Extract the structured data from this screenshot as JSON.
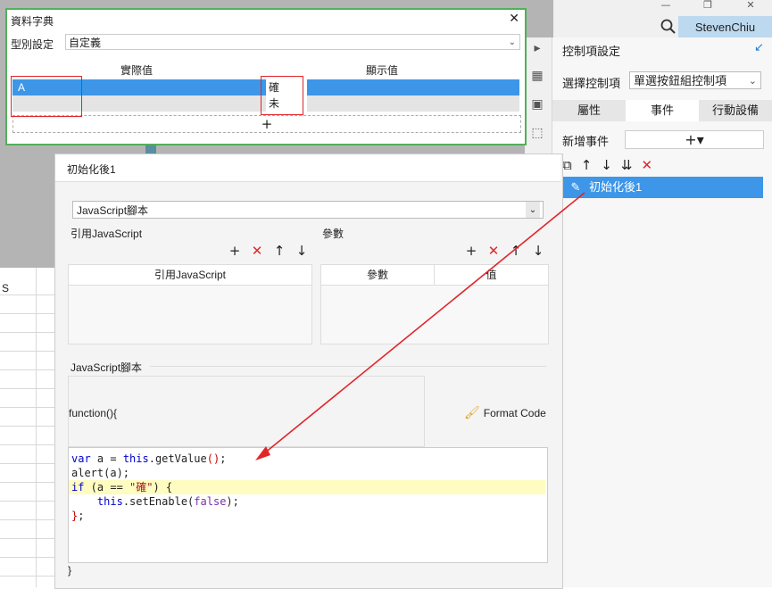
{
  "app": {
    "user": "StevenChiu",
    "window_buttons": {
      "minimize": "—",
      "restore": "❐",
      "close": "✕"
    },
    "sheet_header": "S"
  },
  "dict": {
    "title": "資料字典",
    "type_label": "型別設定",
    "type_value": "自定義",
    "col_actual": "實際值",
    "col_display": "顯示值",
    "rows": [
      {
        "actual": "A",
        "display": "確"
      },
      {
        "actual": "",
        "display": "未"
      }
    ],
    "add": "+"
  },
  "panel": {
    "title": "控制項設定",
    "select_label": "選擇控制項",
    "select_value": "單選按鈕組控制項",
    "tabs": [
      "屬性",
      "事件",
      "行動設備"
    ],
    "add_event_label": "新增事件",
    "add_event_btn": "+▾",
    "event_item": "初始化後1"
  },
  "event_dialog": {
    "title": "初始化後1",
    "script_type": "JavaScript腳本",
    "ref_js_label": "引用JavaScript",
    "params_label": "參數",
    "ref_js_col": "引用JavaScript",
    "param_col": "參數",
    "value_col": "值",
    "script_label": "JavaScript腳本",
    "func_open": "function(){",
    "format_code": "Format Code",
    "func_close": "}",
    "code": [
      "var a = this.getValue();",
      "alert(a);",
      "if (a == \"確\") {",
      "    this.setEnable(false);",
      "};"
    ]
  },
  "colors": {
    "accent": "#3d96e8",
    "red": "#e0262b",
    "green": "#52b05a",
    "highlight": "#fefcc0"
  }
}
